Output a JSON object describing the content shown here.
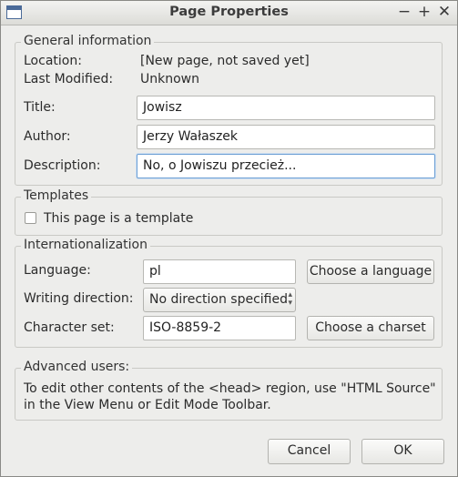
{
  "window": {
    "title": "Page Properties"
  },
  "general": {
    "legend": "General information",
    "location_label": "Location:",
    "location_value": "[New page, not saved yet]",
    "modified_label": "Last Modified:",
    "modified_value": "Unknown",
    "title_label": "Title:",
    "title_value": "Jowisz",
    "author_label": "Author:",
    "author_value": "Jerzy Wałaszek",
    "description_label": "Description:",
    "description_value": "No, o Jowiszu przecież..."
  },
  "templates": {
    "legend": "Templates",
    "checkbox_label": "This page is a template",
    "checked": false
  },
  "i18n": {
    "legend": "Internationalization",
    "language_label": "Language:",
    "language_value": "pl",
    "choose_language": "Choose a language",
    "direction_label": "Writing direction:",
    "direction_value": "No direction specified",
    "charset_label": "Character set:",
    "charset_value": "ISO-8859-2",
    "choose_charset": "Choose a charset"
  },
  "advanced": {
    "legend": "Advanced users:",
    "text": "To edit other contents of the <head> region, use \"HTML Source\" in the View Menu or Edit Mode Toolbar."
  },
  "footer": {
    "cancel": "Cancel",
    "ok": "OK"
  }
}
